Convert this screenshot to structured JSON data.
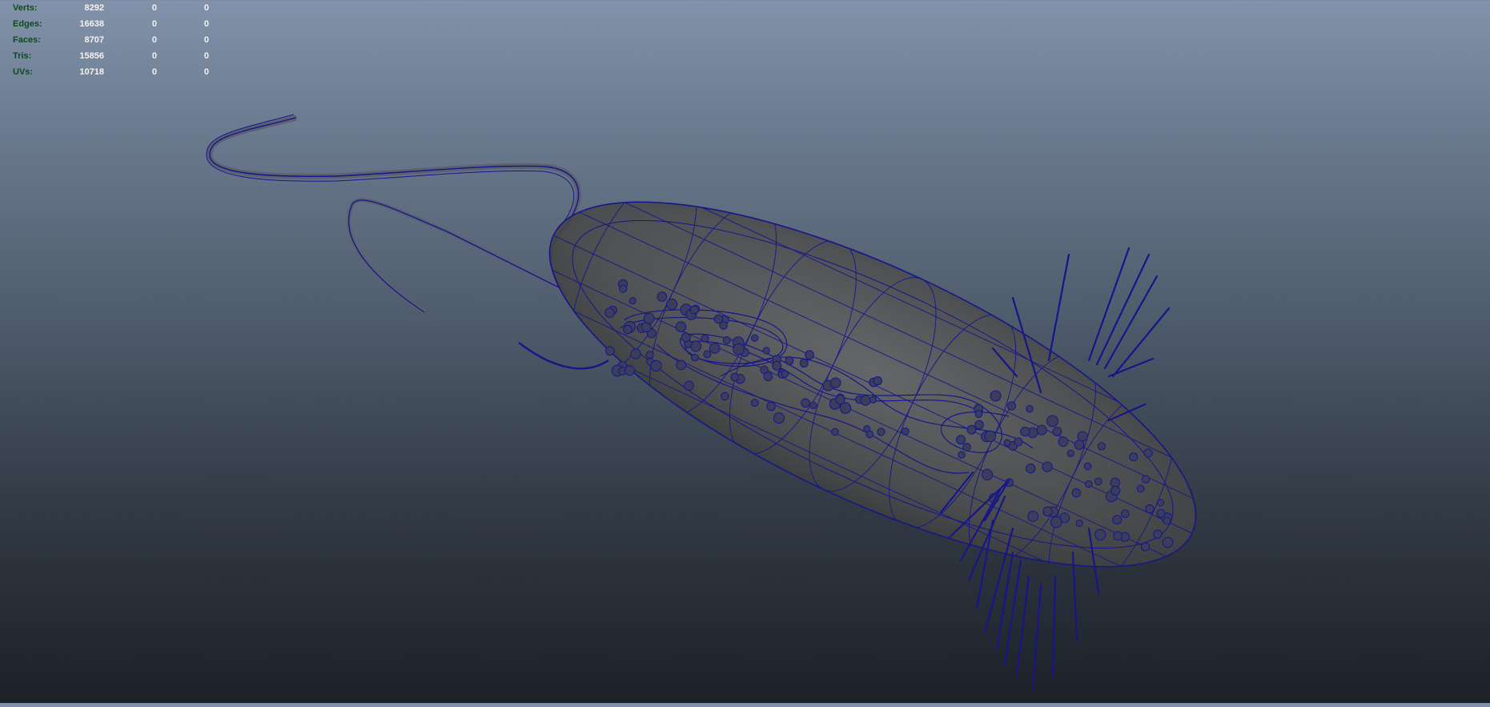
{
  "viewport": {
    "background_top": "#8192aa",
    "background_bottom": "#1c2128",
    "wireframe_color": "#16168a",
    "shaded_color": "#5a5a5a",
    "object_icon": "bacterium-wireframe"
  },
  "hud": {
    "rows": [
      {
        "label": "Verts:",
        "value": "8292",
        "col2": "0",
        "col3": "0"
      },
      {
        "label": "Edges:",
        "value": "16638",
        "col2": "0",
        "col3": "0"
      },
      {
        "label": "Faces:",
        "value": "8707",
        "col2": "0",
        "col3": "0"
      },
      {
        "label": "Tris:",
        "value": "15856",
        "col2": "0",
        "col3": "0"
      },
      {
        "label": "UVs:",
        "value": "10718",
        "col2": "0",
        "col3": "0"
      }
    ]
  }
}
